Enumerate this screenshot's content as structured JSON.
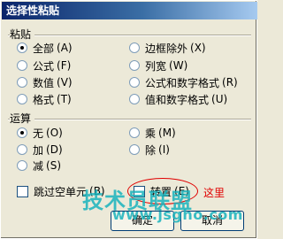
{
  "title": "选择性粘贴",
  "paste": {
    "label": "粘贴",
    "options": [
      {
        "label": "全部",
        "key": "(A)",
        "checked": true
      },
      {
        "label": "公式",
        "key": "(F)",
        "checked": false
      },
      {
        "label": "数值",
        "key": "(V)",
        "checked": false
      },
      {
        "label": "格式",
        "key": "(T)",
        "checked": false
      },
      {
        "label": "边框除外",
        "key": "(X)",
        "checked": false
      },
      {
        "label": "列宽",
        "key": "(W)",
        "checked": false
      },
      {
        "label": "公式和数字格式",
        "key": "(R)",
        "checked": false
      },
      {
        "label": "值和数字格式",
        "key": "(U)",
        "checked": false
      }
    ]
  },
  "operation": {
    "label": "运算",
    "options": [
      {
        "label": "无",
        "key": "(O)",
        "checked": true
      },
      {
        "label": "加",
        "key": "(D)",
        "checked": false
      },
      {
        "label": "减",
        "key": "(S)",
        "checked": false
      },
      {
        "label": "乘",
        "key": "(M)",
        "checked": false
      },
      {
        "label": "除",
        "key": "(I)",
        "checked": false
      }
    ]
  },
  "skip_blanks": {
    "label": "跳过空单元",
    "key": "(B)",
    "checked": false
  },
  "transpose": {
    "label": "转置",
    "key": "(E)",
    "checked": false
  },
  "annotation": "这里",
  "buttons": {
    "ok": "确定",
    "cancel": "取消"
  },
  "watermark": {
    "line1": "技术员联盟",
    "line2": "www.jsgho.com"
  },
  "colors": {
    "title_bar": "#0a246a",
    "annotation": "#e00000",
    "watermark": "#19b3bd"
  }
}
